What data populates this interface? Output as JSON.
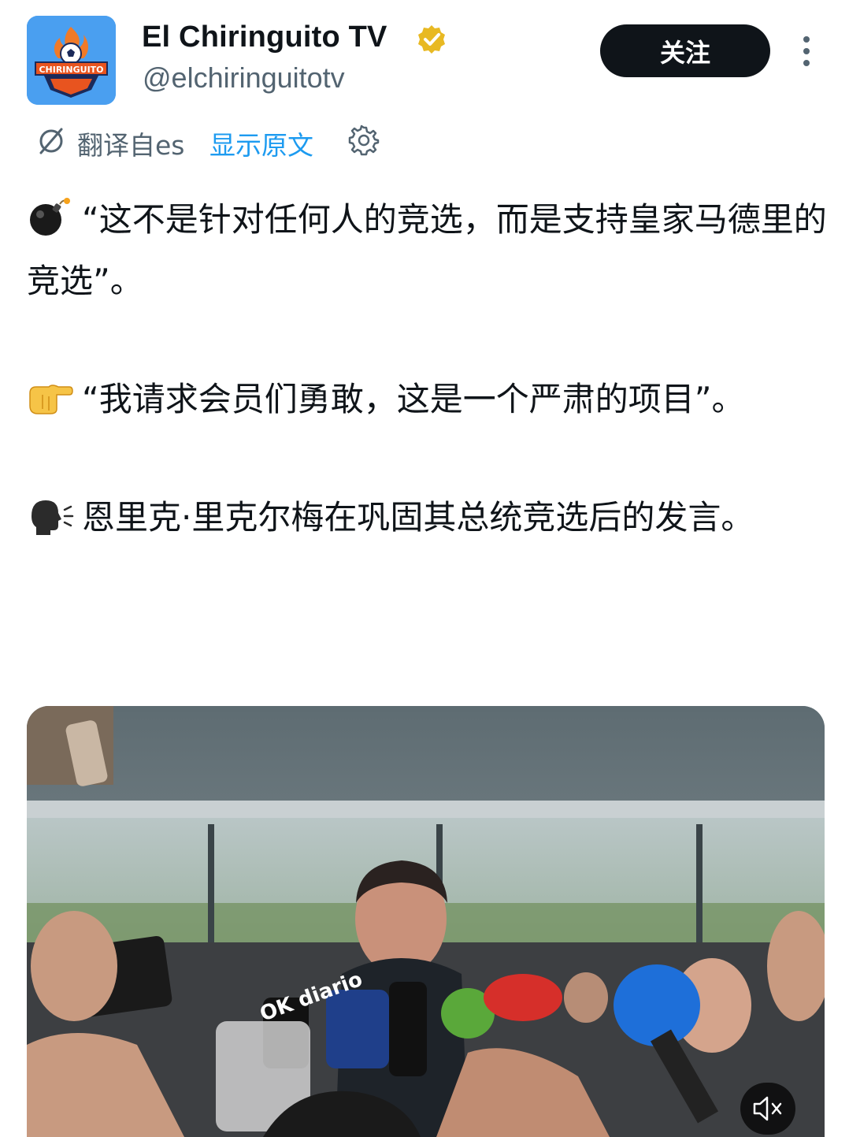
{
  "account": {
    "display_name": "El Chiringuito TV",
    "handle": "@elchiringuitotv",
    "logo_text": "CHIRINGUITO",
    "verified": true
  },
  "actions": {
    "follow_label": "关注",
    "more_icon": "more-vertical-icon"
  },
  "translation": {
    "translated_from": "翻译自es",
    "show_original": "显示原文"
  },
  "tweet": {
    "paragraphs": [
      {
        "emoji": "bomb",
        "text": "“这不是针对任何人的竞选，而是支持皇家马德里的竞选”。"
      },
      {
        "emoji": "backhand-index-pointing-right",
        "text": "“我请求会员们勇敢，这是一个严肃的项目”。"
      },
      {
        "emoji": "speaking-head",
        "text": "恩里克·里克尔梅在巩固其总统竞选后的发言。"
      }
    ]
  },
  "media": {
    "type": "video",
    "muted": true,
    "mic_flag_text": "OK diario"
  },
  "colors": {
    "link": "#1d9bf0",
    "secondary_text": "#536471",
    "follow_bg": "#0f1419",
    "verified_gold": "#e8b923"
  }
}
